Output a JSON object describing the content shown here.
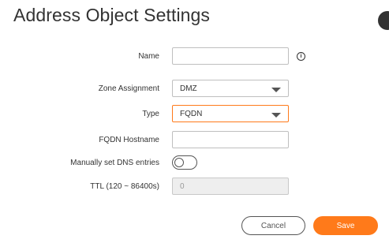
{
  "dialog": {
    "title": "Address Object Settings"
  },
  "form": {
    "name": {
      "label": "Name",
      "value": ""
    },
    "zone": {
      "label": "Zone Assignment",
      "value": "DMZ"
    },
    "type": {
      "label": "Type",
      "value": "FQDN"
    },
    "fqdn_hostname": {
      "label": "FQDN Hostname",
      "value": ""
    },
    "manual_dns": {
      "label": "Manually set DNS entries",
      "enabled": false
    },
    "ttl": {
      "label": "TTL (120 ~ 86400s)",
      "value": "0"
    }
  },
  "info_icon_glyph": "i",
  "buttons": {
    "cancel": "Cancel",
    "save": "Save"
  },
  "colors": {
    "accent": "#ff7a1a",
    "text": "#333333"
  }
}
